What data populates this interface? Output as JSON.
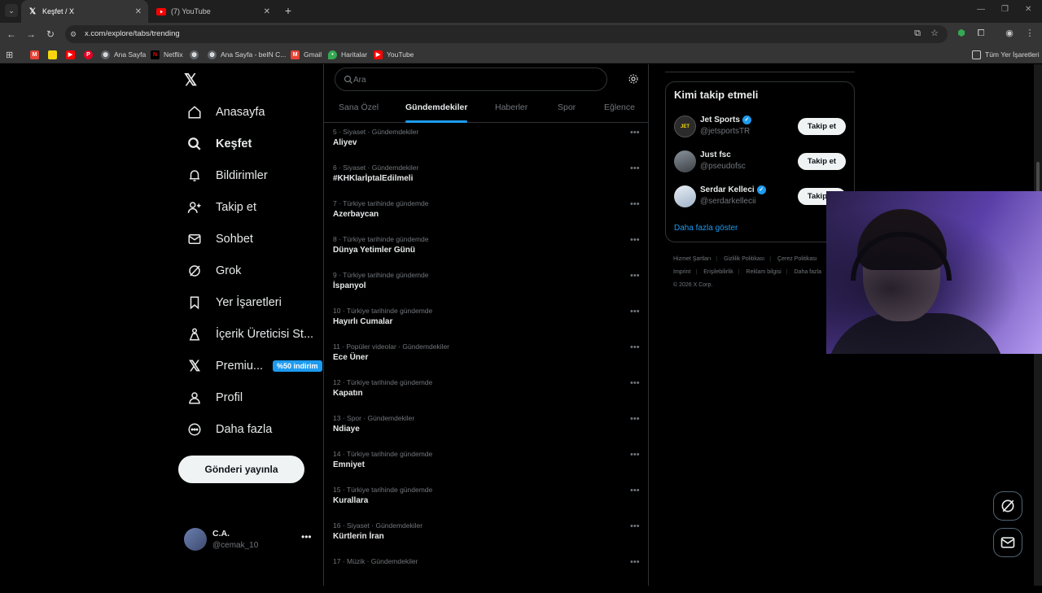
{
  "browser": {
    "tabs": [
      {
        "title": "Keşfet / X",
        "active": true
      },
      {
        "title": "(7) YouTube",
        "active": false
      }
    ],
    "url": "x.com/explore/tabs/trending",
    "bookmarks": [
      {
        "label": "",
        "icon": "gmail-icon",
        "color": "#ea4335"
      },
      {
        "label": "",
        "icon": "yellow-bookmark-icon",
        "color": "#f5d90a"
      },
      {
        "label": "",
        "icon": "youtube-icon",
        "color": "#ff0000"
      },
      {
        "label": "",
        "icon": "pinterest-icon",
        "color": "#e60023"
      },
      {
        "label": "Ana Sayfa",
        "icon": "globe-icon",
        "color": "#5f6368"
      },
      {
        "label": "Netflix",
        "icon": "netflix-icon",
        "color": "#e50914"
      },
      {
        "label": "",
        "icon": "globe-icon",
        "color": "#5f6368"
      },
      {
        "label": "Ana Sayfa - beIN C...",
        "icon": "globe-icon",
        "color": "#5f6368"
      },
      {
        "label": "Gmail",
        "icon": "gmail-icon",
        "color": "#ea4335"
      },
      {
        "label": "Haritalar",
        "icon": "maps-icon",
        "color": "#34a853"
      },
      {
        "label": "YouTube",
        "icon": "youtube-icon",
        "color": "#ff0000"
      }
    ],
    "all_bookmarks": "Tüm Yer İşaretleri"
  },
  "nav": {
    "items": [
      {
        "label": "Anasayfa",
        "icon": "home-icon"
      },
      {
        "label": "Keşfet",
        "icon": "search-icon",
        "bold": true
      },
      {
        "label": "Bildirimler",
        "icon": "bell-icon"
      },
      {
        "label": "Takip et",
        "icon": "add-user-icon"
      },
      {
        "label": "Sohbet",
        "icon": "mail-icon"
      },
      {
        "label": "Grok",
        "icon": "grok-icon"
      },
      {
        "label": "Yer İşaretleri",
        "icon": "bookmark-icon"
      },
      {
        "label": "İçerik Üreticisi St...",
        "icon": "creator-icon"
      },
      {
        "label": "Premiu...",
        "icon": "x-premium-icon",
        "badge": "%50 indirim"
      },
      {
        "label": "Profil",
        "icon": "profile-icon"
      },
      {
        "label": "Daha fazla",
        "icon": "more-circle-icon"
      }
    ],
    "post_button": "Gönderi yayınla",
    "account": {
      "name": "C.A.",
      "handle": "@cemak_10"
    }
  },
  "search": {
    "placeholder": "Ara"
  },
  "explore_tabs": [
    {
      "label": "Sana Özel",
      "active": false
    },
    {
      "label": "Gündemdekiler",
      "active": true
    },
    {
      "label": "Haberler",
      "active": false
    },
    {
      "label": "Spor",
      "active": false
    },
    {
      "label": "Eğlence",
      "active": false
    }
  ],
  "trends": [
    {
      "rank": "5",
      "category": "Siyaset · Gündemdekiler",
      "title": "Aliyev"
    },
    {
      "rank": "6",
      "category": "Siyaset · Gündemdekiler",
      "title": "#KHKlarİptalEdilmeli"
    },
    {
      "rank": "7",
      "category": "Türkiye tarihinde gündemde",
      "title": "Azerbaycan"
    },
    {
      "rank": "8",
      "category": "Türkiye tarihinde gündemde",
      "title": "Dünya Yetimler Günü"
    },
    {
      "rank": "9",
      "category": "Türkiye tarihinde gündemde",
      "title": "İspanyol"
    },
    {
      "rank": "10",
      "category": "Türkiye tarihinde gündemde",
      "title": "Hayırlı Cumalar"
    },
    {
      "rank": "11",
      "category": "Popüler videolar · Gündemdekiler",
      "title": "Ece Üner"
    },
    {
      "rank": "12",
      "category": "Türkiye tarihinde gündemde",
      "title": "Kapatın"
    },
    {
      "rank": "13",
      "category": "Spor · Gündemdekiler",
      "title": "Ndiaye"
    },
    {
      "rank": "14",
      "category": "Türkiye tarihinde gündemde",
      "title": "Emniyet"
    },
    {
      "rank": "15",
      "category": "Türkiye tarihinde gündemde",
      "title": "Kurallara"
    },
    {
      "rank": "16",
      "category": "Siyaset · Gündemdekiler",
      "title": "Kürtlerin İran"
    },
    {
      "rank": "17",
      "category": "Müzik · Gündemdekiler",
      "title": ""
    }
  ],
  "who_to_follow": {
    "title": "Kimi takip etmeli",
    "users": [
      {
        "name": "Jet Sports",
        "handle": "@jetsportsTR",
        "verified": true,
        "button": "Takip et",
        "avatar_color": "#2b2b2b"
      },
      {
        "name": "Just fsc",
        "handle": "@pseudofsc",
        "verified": false,
        "button": "Takip et",
        "avatar_color": "#55606b"
      },
      {
        "name": "Serdar Kelleci",
        "handle": "@serdarkellecii",
        "verified": true,
        "button": "Takip et",
        "avatar_color": "#c9d6e3"
      }
    ],
    "show_more": "Daha fazla göster"
  },
  "footer": {
    "line1": [
      "Hizmet Şartları",
      "Gizlilik Politikası",
      "Çerez Politikası"
    ],
    "line2": [
      "Imprint",
      "Erişilebilirlik",
      "Reklam bilgisi",
      "Daha fazla"
    ],
    "copyright": "© 2026 X Corp."
  },
  "colors": {
    "accent": "#1d9bf0",
    "background": "#000000",
    "muted": "#71767b",
    "text": "#e7e9ea"
  }
}
